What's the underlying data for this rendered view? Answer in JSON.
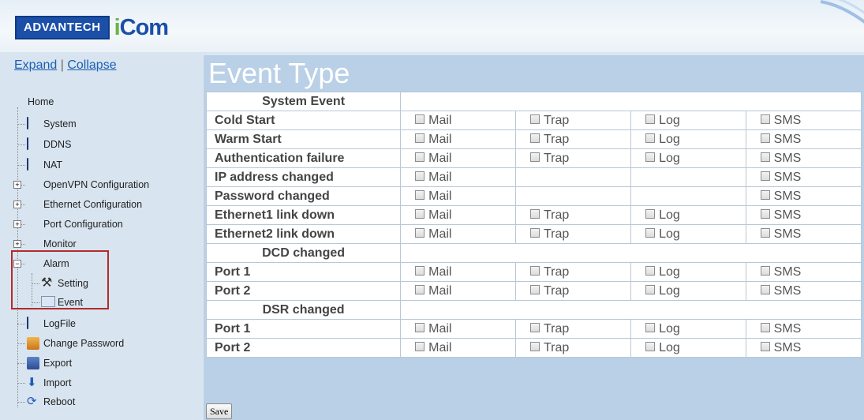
{
  "header": {
    "logo_text": "ADVANTECH",
    "logo_icom": "iCom"
  },
  "sidebar": {
    "expand": "Expand",
    "separator": "|",
    "collapse": "Collapse",
    "items": [
      {
        "label": "Home",
        "icon": "home-icon"
      },
      {
        "label": "System",
        "icon": "page-icon"
      },
      {
        "label": "DDNS",
        "icon": "page-icon"
      },
      {
        "label": "NAT",
        "icon": "page-icon"
      },
      {
        "label": "OpenVPN Configuration",
        "icon": "folder-icon"
      },
      {
        "label": "Ethernet Configuration",
        "icon": "folder-icon"
      },
      {
        "label": "Port Configuration",
        "icon": "folder-icon"
      },
      {
        "label": "Monitor",
        "icon": "folder-icon"
      },
      {
        "label": "Alarm",
        "icon": "folder-open-icon"
      },
      {
        "label": "Setting",
        "icon": "tools-icon"
      },
      {
        "label": "Event",
        "icon": "event-icon"
      },
      {
        "label": "LogFile",
        "icon": "page-icon"
      },
      {
        "label": "Change Password",
        "icon": "key-icon"
      },
      {
        "label": "Export",
        "icon": "save-icon"
      },
      {
        "label": "Import",
        "icon": "import-icon"
      },
      {
        "label": "Reboot",
        "icon": "reboot-icon"
      }
    ]
  },
  "main": {
    "title": "Event Type",
    "save_label": "Save",
    "options": {
      "mail": "Mail",
      "trap": "Trap",
      "log": "Log",
      "sms": "SMS"
    },
    "sections": [
      {
        "title": "System Event",
        "rows": [
          {
            "name": "Cold Start",
            "mail": true,
            "trap": true,
            "log": true,
            "sms": true
          },
          {
            "name": "Warm Start",
            "mail": true,
            "trap": true,
            "log": true,
            "sms": true
          },
          {
            "name": "Authentication failure",
            "mail": true,
            "trap": true,
            "log": true,
            "sms": true
          },
          {
            "name": "IP address changed",
            "mail": true,
            "trap": false,
            "log": false,
            "sms": true
          },
          {
            "name": "Password changed",
            "mail": true,
            "trap": false,
            "log": false,
            "sms": true
          },
          {
            "name": "Ethernet1 link down",
            "mail": true,
            "trap": true,
            "log": true,
            "sms": true
          },
          {
            "name": "Ethernet2 link down",
            "mail": true,
            "trap": true,
            "log": true,
            "sms": true
          }
        ]
      },
      {
        "title": "DCD changed",
        "rows": [
          {
            "name": "Port 1",
            "mail": true,
            "trap": true,
            "log": true,
            "sms": true
          },
          {
            "name": "Port 2",
            "mail": true,
            "trap": true,
            "log": true,
            "sms": true
          }
        ]
      },
      {
        "title": "DSR changed",
        "rows": [
          {
            "name": "Port 1",
            "mail": true,
            "trap": true,
            "log": true,
            "sms": true
          },
          {
            "name": "Port 2",
            "mail": true,
            "trap": true,
            "log": true,
            "sms": true
          }
        ]
      }
    ]
  }
}
